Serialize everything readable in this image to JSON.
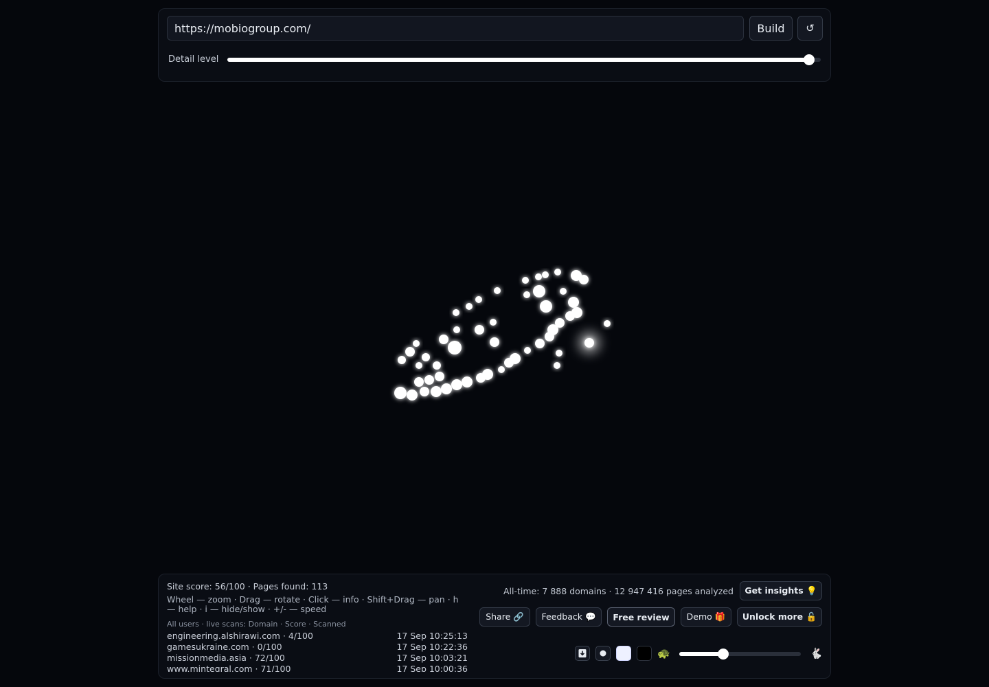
{
  "toolbar": {
    "url_value": "https://mobiogroup.com/",
    "build_label": "Build",
    "reset_icon": "↺",
    "detail_label": "Detail level",
    "detail_level": 0.98
  },
  "status": {
    "site_score": "Site score: 56/100 · Pages found: 113",
    "help": "Wheel — zoom · Drag — rotate · Click — info · Shift+Drag — pan · h — help · i — hide/show · +/- — speed",
    "scans_header": "All users · live scans: Domain · Score · Scanned",
    "scans": [
      {
        "domain": "engineering.alshirawi.com · 4/100",
        "time": "17 Sep 10:25:13"
      },
      {
        "domain": "gamesukraine.com · 0/100",
        "time": "17 Sep 10:22:36"
      },
      {
        "domain": "missionmedia.asia · 72/100",
        "time": "17 Sep 10:03:21"
      },
      {
        "domain": "www.mintegral.com · 71/100",
        "time": "17 Sep 10:00:36"
      }
    ],
    "alltime": "All-time: 7 888 domains · 12 947 416 pages analyzed"
  },
  "actions": {
    "insights": "Get insights 💡",
    "share": "Share 🔗",
    "feedback": "Feedback 💬",
    "review": "Free review",
    "demo": "Demo 🎁",
    "unlock": "Unlock more 🔓"
  },
  "controls": {
    "download_icon": "download-icon",
    "dot_icon": "dot-icon",
    "turtle": "🐢",
    "rabbit": "🐇",
    "speed_level": 0.36
  },
  "colors": {
    "background": "#05070c",
    "node": "#ffffff",
    "panel": "#0a0d14"
  }
}
